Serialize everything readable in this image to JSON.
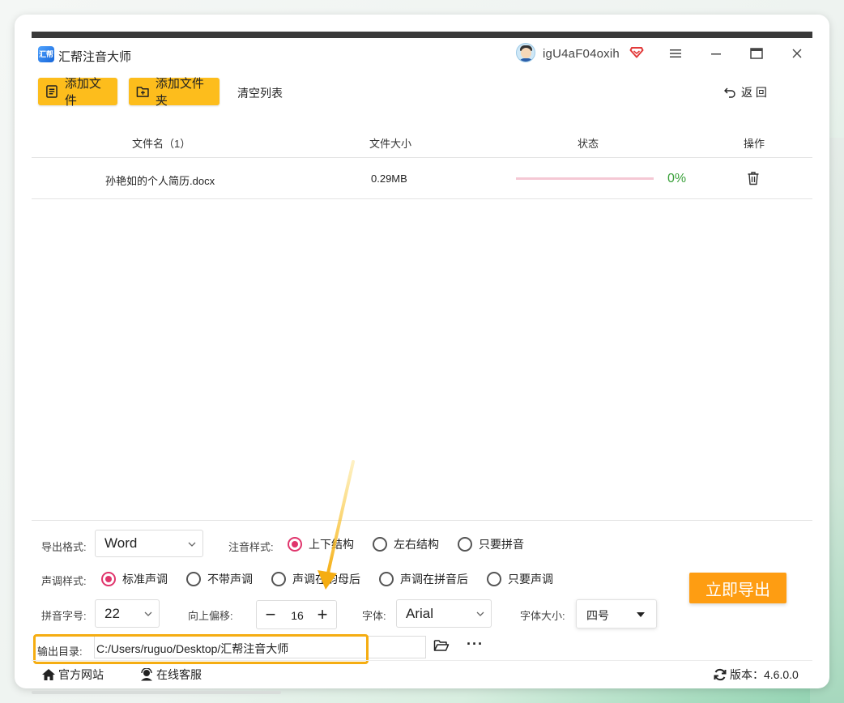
{
  "app": {
    "title": "汇帮注音大师",
    "logo_text": "汇帮",
    "username": "igU4aF04oxih"
  },
  "toolbar": {
    "add_file": "添加文件",
    "add_folder": "添加文件夹",
    "clear_list": "清空列表",
    "back": "返 回"
  },
  "table": {
    "columns": [
      "文件名（1）",
      "文件大小",
      "状态",
      "操作"
    ],
    "rows": [
      {
        "name": "孙艳如的个人简历.docx",
        "size": "0.29MB",
        "progress": 0,
        "progress_text": "0%"
      }
    ]
  },
  "settings": {
    "export_format_label": "导出格式:",
    "export_format_value": "Word",
    "annotation_style_label": "注音样式:",
    "annotation_options": [
      "上下结构",
      "左右结构",
      "只要拼音"
    ],
    "annotation_selected": 0,
    "tone_style_label": "声调样式:",
    "tone_options": [
      "标准声调",
      "不带声调",
      "声调在韵母后",
      "声调在拼音后",
      "只要声调"
    ],
    "tone_selected": 0,
    "pinyin_size_label": "拼音字号:",
    "pinyin_size_value": "22",
    "offset_label": "向上偏移:",
    "offset_value": "16",
    "font_label": "字体:",
    "font_value": "Arial",
    "font_size_label": "字体大小:",
    "font_size_value": "四号",
    "export_now": "立即导出",
    "output_dir_label": "输出目录:",
    "output_dir_value": "C:/Users/ruguo/Desktop/汇帮注音大师"
  },
  "footer": {
    "official_site": "官方网站",
    "online_service": "在线客服",
    "version_label": "版本：4.6.0.0"
  },
  "colors": {
    "accent_yellow": "#fdbd1c",
    "export_orange": "#fe9d12",
    "radio_pink": "#e0356c",
    "progress_green": "#3aa13a",
    "highlight_border": "#f5ad12"
  }
}
